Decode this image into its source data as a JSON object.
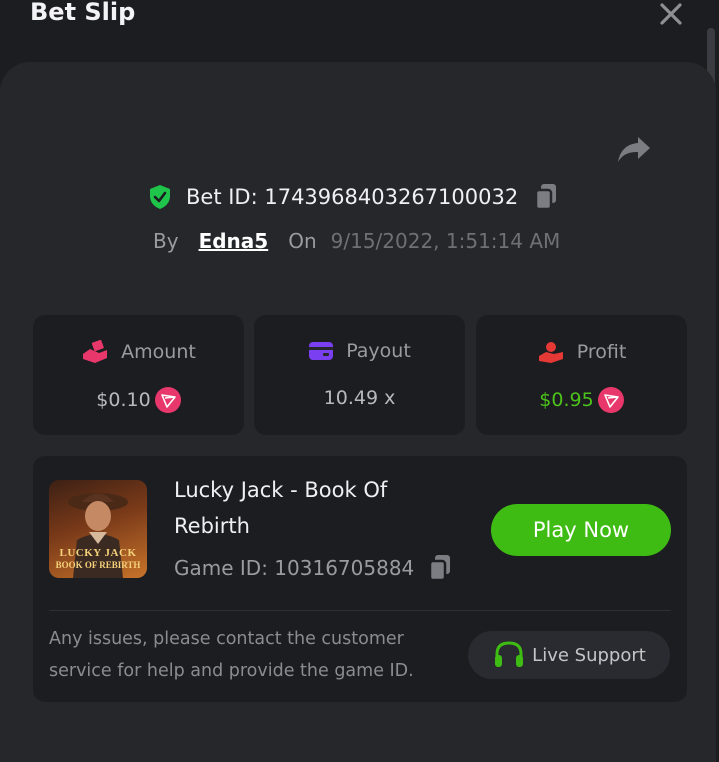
{
  "header": {
    "title": "Bet Slip",
    "close_icon": "close-icon"
  },
  "bet": {
    "id_label": "Bet ID: 1743968403267100032",
    "by_label": "By",
    "user": "Edna5",
    "on_label": "On",
    "date": "9/15/2022, 1:51:14 AM"
  },
  "stats": {
    "amount": {
      "label": "Amount",
      "value": "$0.10",
      "icon": "hand-coins-icon",
      "color": "#e8386b"
    },
    "payout": {
      "label": "Payout",
      "value": "10.49 x",
      "icon": "card-icon",
      "color": "#7b3ff2"
    },
    "profit": {
      "label": "Profit",
      "value": "$0.95",
      "icon": "hand-heart-icon",
      "color": "#e53935",
      "value_color": "#4cc21a"
    }
  },
  "game": {
    "title": "Lucky Jack - Book Of Rebirth",
    "thumb_line1": "LUCKY JACK",
    "thumb_line2": "BOOK OF REBIRTH",
    "game_id_label": "Game ID: 10316705884",
    "play_label": "Play Now"
  },
  "support": {
    "text": "Any issues, please contact the customer service for help and provide the game ID.",
    "button_label": "Live Support"
  },
  "colors": {
    "accent_green": "#3fbc13",
    "shield_green": "#1fc54a",
    "trx_red": "#e8386b"
  }
}
